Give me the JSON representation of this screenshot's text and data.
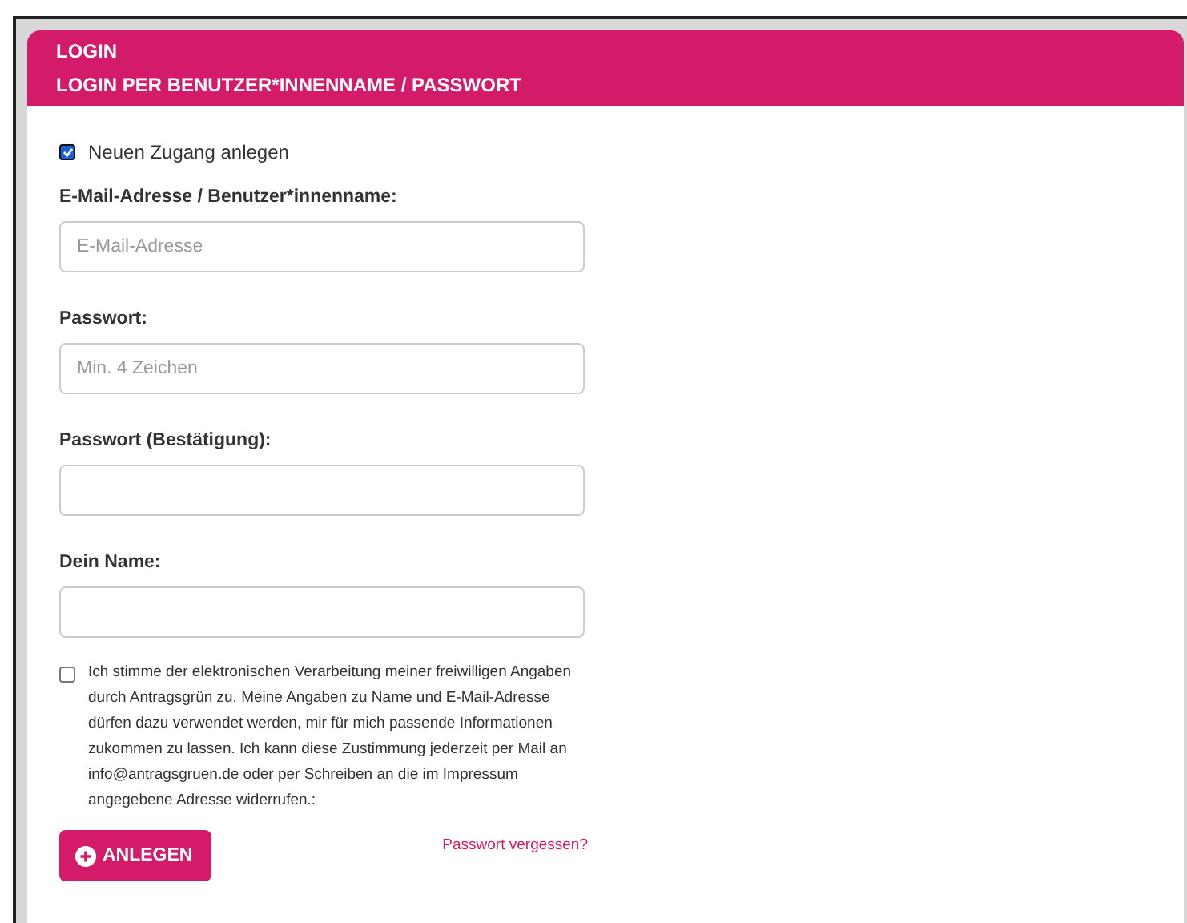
{
  "header": {
    "title": "LOGIN",
    "subtitle": "LOGIN PER BENUTZER*INNENNAME / PASSWORT"
  },
  "new_account": {
    "label": "Neuen Zugang anlegen",
    "checked": true
  },
  "fields": [
    {
      "label": "E-Mail-Adresse / Benutzer*innenname:",
      "placeholder": "E-Mail-Adresse"
    },
    {
      "label": "Passwort:",
      "placeholder": "Min. 4 Zeichen"
    },
    {
      "label": "Passwort (Bestätigung):"
    },
    {
      "label": "Dein Name:"
    }
  ],
  "consent": {
    "text": "Ich stimme der elektronischen Verarbeitung meiner freiwilligen Angaben durch Antragsgrün zu. Meine Angaben zu Name und E-Mail-Adresse dürfen dazu verwendet werden, mir für mich passende Informationen zukommen zu lassen. Ich kann diese Zustimmung jederzeit per Mail an info@antragsgruen.de oder per Schreiben an die im Impressum angegebene Adresse widerrufen.:",
    "checked": false
  },
  "submit_button": "ANLEGEN",
  "forgot_link": "Passwort vergessen?"
}
